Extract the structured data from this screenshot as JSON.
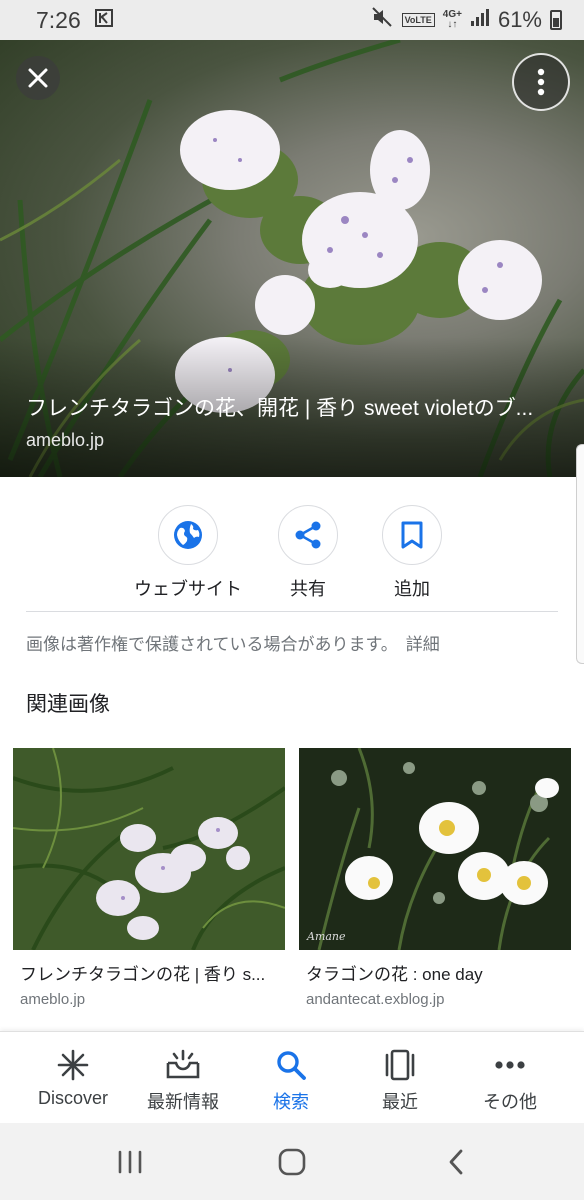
{
  "status_bar": {
    "time": "7:26",
    "left_icon": "notification-k-icon",
    "volte": "VoLTE",
    "network": "4G+",
    "battery_percent": "61%"
  },
  "hero": {
    "title": "フレンチタラゴンの花、開花 | 香り sweet violetのブ...",
    "source": "ameblo.jp",
    "close_icon": "close-icon",
    "more_icon": "more-vert-icon"
  },
  "actions": [
    {
      "label": "ウェブサイト",
      "icon": "globe-icon"
    },
    {
      "label": "共有",
      "icon": "share-icon"
    },
    {
      "label": "追加",
      "icon": "bookmark-icon"
    }
  ],
  "copyright": {
    "text": "画像は著作権で保護されている場合があります。",
    "detail_link": "詳細"
  },
  "related": {
    "heading": "関連画像",
    "items": [
      {
        "caption": "フレンチタラゴンの花 | 香り s...",
        "source": "ameblo.jp"
      },
      {
        "caption": "タラゴンの花 : one day",
        "source": "andantecat.exblog.jp",
        "watermark": "Amane"
      }
    ]
  },
  "bottom_nav": [
    {
      "label": "Discover",
      "icon": "discover-asterisk-icon",
      "active": false
    },
    {
      "label": "最新情報",
      "icon": "updates-inbox-icon",
      "active": false
    },
    {
      "label": "検索",
      "icon": "search-icon",
      "active": true
    },
    {
      "label": "最近",
      "icon": "recent-cards-icon",
      "active": false
    },
    {
      "label": "その他",
      "icon": "more-horiz-icon",
      "active": false
    }
  ],
  "colors": {
    "accent": "#1a73e8",
    "text_primary": "#202124",
    "text_secondary": "#70757a"
  }
}
